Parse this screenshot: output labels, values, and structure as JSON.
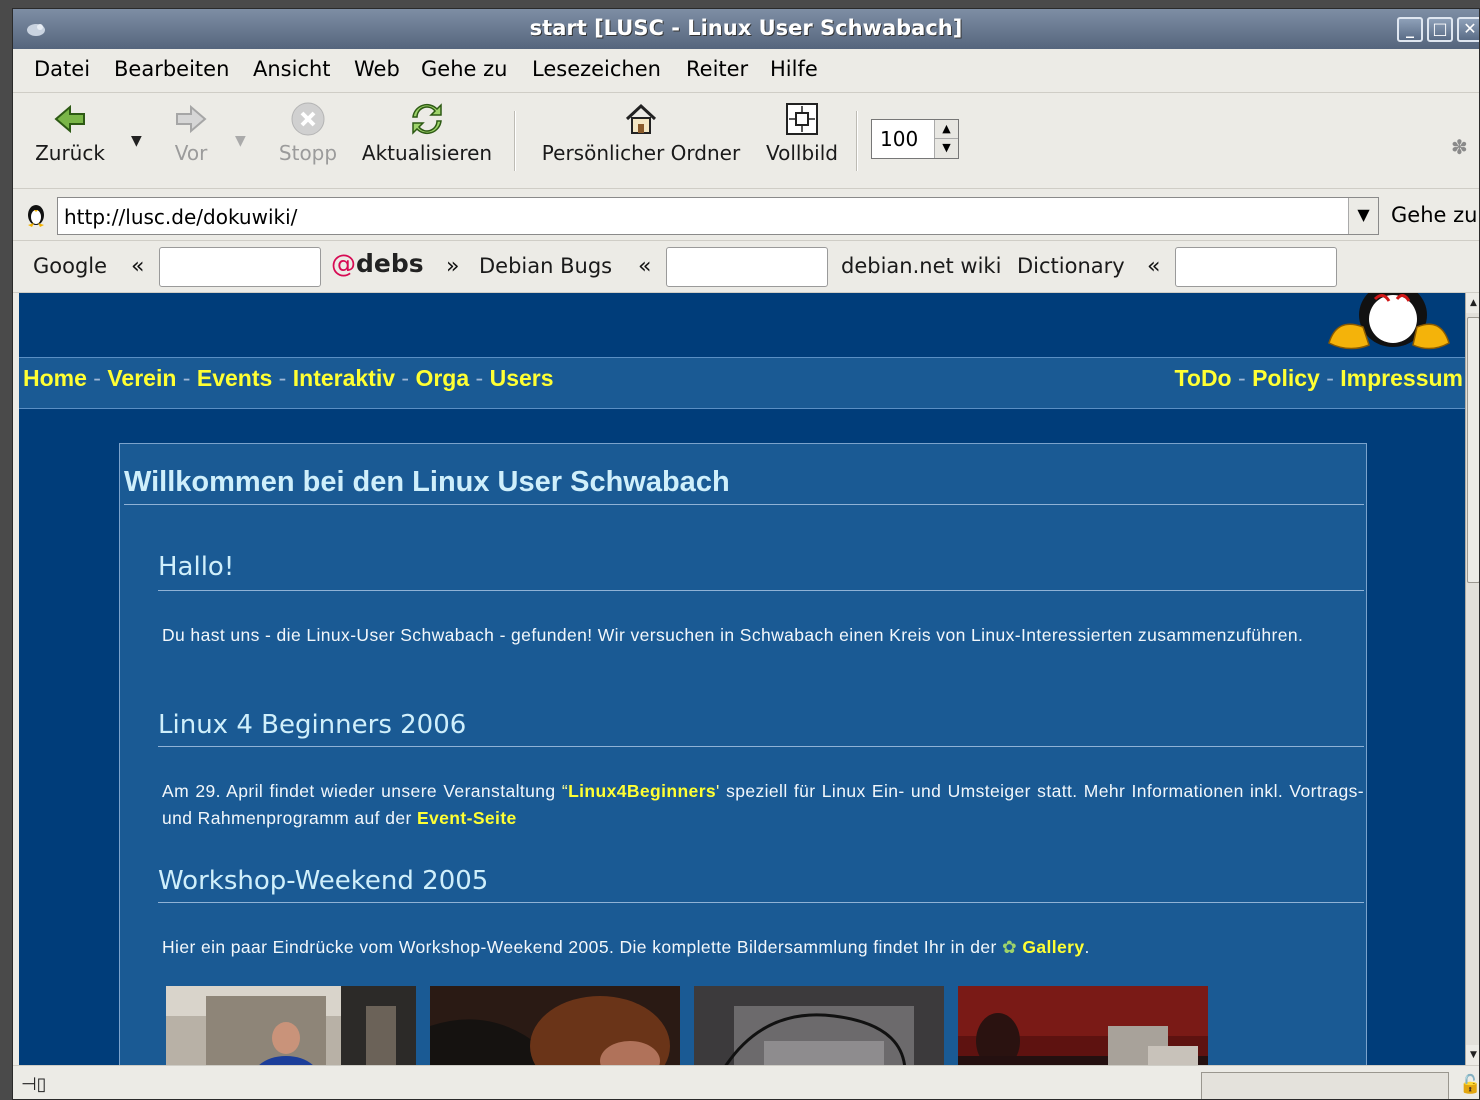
{
  "window": {
    "title": "start [LUSC - Linux User Schwabach]",
    "buttons": [
      "_",
      "□",
      "✕"
    ]
  },
  "menu": [
    "Datei",
    "Bearbeiten",
    "Ansicht",
    "Web",
    "Gehe zu",
    "Lesezeichen",
    "Reiter",
    "Hilfe"
  ],
  "toolbar": {
    "back": "Zurück",
    "forward": "Vor",
    "stop": "Stopp",
    "reload": "Aktualisieren",
    "home": "Persönlicher Ordner",
    "fullscreen": "Vollbild",
    "zoom": "100"
  },
  "location": {
    "url": "http://lusc.de/dokuwiki/",
    "go": "Gehe zu"
  },
  "searchbar": {
    "google": "Google",
    "debs": "debs",
    "debian_bugs": "Debian Bugs",
    "debian_wiki": "debian.net wiki",
    "dictionary": "Dictionary",
    "open_chevron": "«",
    "close_chevron": "»"
  },
  "nav": {
    "left": [
      "Home",
      "Verein",
      "Events",
      "Interaktiv",
      "Orga",
      "Users"
    ],
    "right": [
      "ToDo",
      "Policy",
      "Impressum"
    ],
    "separator": " - "
  },
  "page": {
    "title": "Willkommen bei den Linux User Schwabach",
    "sections": [
      {
        "heading": "Hallo!",
        "text": "Du hast uns - die Linux-User Schwabach - gefunden! Wir versuchen in Schwabach einen Kreis von Linux-Interessierten zusammenzuführen."
      },
      {
        "heading": "Linux 4 Beginners 2006",
        "text_before": "Am 29. April findet wieder unsere Veranstaltung ",
        "quote_open": "“",
        "link1": "Linux4Beginners",
        "quote_close": "'",
        "text_middle": " speziell für Linux Ein- und Umsteiger statt. Mehr Informationen inkl. Vortrags- und Rahmenprogramm auf der ",
        "link2": "Event-Seite"
      },
      {
        "heading": "Workshop-Weekend 2005",
        "text_before": "Hier ein paar Eindrücke vom Workshop-Weekend 2005. Die komplette Bildersammlung findet Ihr in der ",
        "link": "Gallery",
        "text_after": "."
      }
    ]
  },
  "colors": {
    "page_bg": "#003d7a",
    "content_bg": "#1a5a94",
    "link": "#ffff33",
    "heading": "#cfeffb"
  }
}
